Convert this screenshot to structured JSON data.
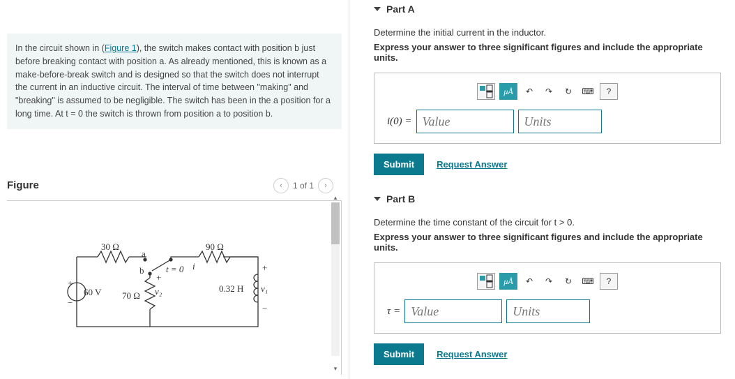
{
  "problem": {
    "prefix": "In the circuit shown in (",
    "figure_link": "Figure 1",
    "suffix": "), the switch makes contact with position b just before breaking contact with position a. As already mentioned, this is known as a make-before-break switch and is designed so that the switch does not interrupt the current in an inductive circuit. The interval of time between \"making\" and \"breaking\" is assumed to be negligible. The switch has been in the a position for a long time. At t = 0 the switch is thrown from position a to position b."
  },
  "figure": {
    "title": "Figure",
    "pager": "1 of 1",
    "labels": {
      "r1": "30 Ω",
      "r2": "90 Ω",
      "r3": "70 Ω",
      "v_src": "60 V",
      "L": "0.32 H",
      "a": "a",
      "b": "b",
      "t0": "t = 0",
      "i": "i",
      "v1": "v₁",
      "v2": "v₂",
      "plus": "+",
      "minus": "−"
    }
  },
  "parts": {
    "a": {
      "title": "Part A",
      "question": "Determine the initial current in the inductor.",
      "instruction": "Express your answer to three significant figures and include the appropriate units.",
      "lhs": "i(0) =",
      "value_placeholder": "Value",
      "units_placeholder": "Units"
    },
    "b": {
      "title": "Part B",
      "question": "Determine the time constant of the circuit for t > 0.",
      "instruction": "Express your answer to three significant figures and include the appropriate units.",
      "lhs": "τ =",
      "value_placeholder": "Value",
      "units_placeholder": "Units"
    }
  },
  "toolbar": {
    "mu": "μÅ",
    "undo": "↶",
    "redo": "↷",
    "reset": "↻",
    "keyboard": "⌨",
    "help": "?"
  },
  "actions": {
    "submit": "Submit",
    "request": "Request Answer"
  }
}
